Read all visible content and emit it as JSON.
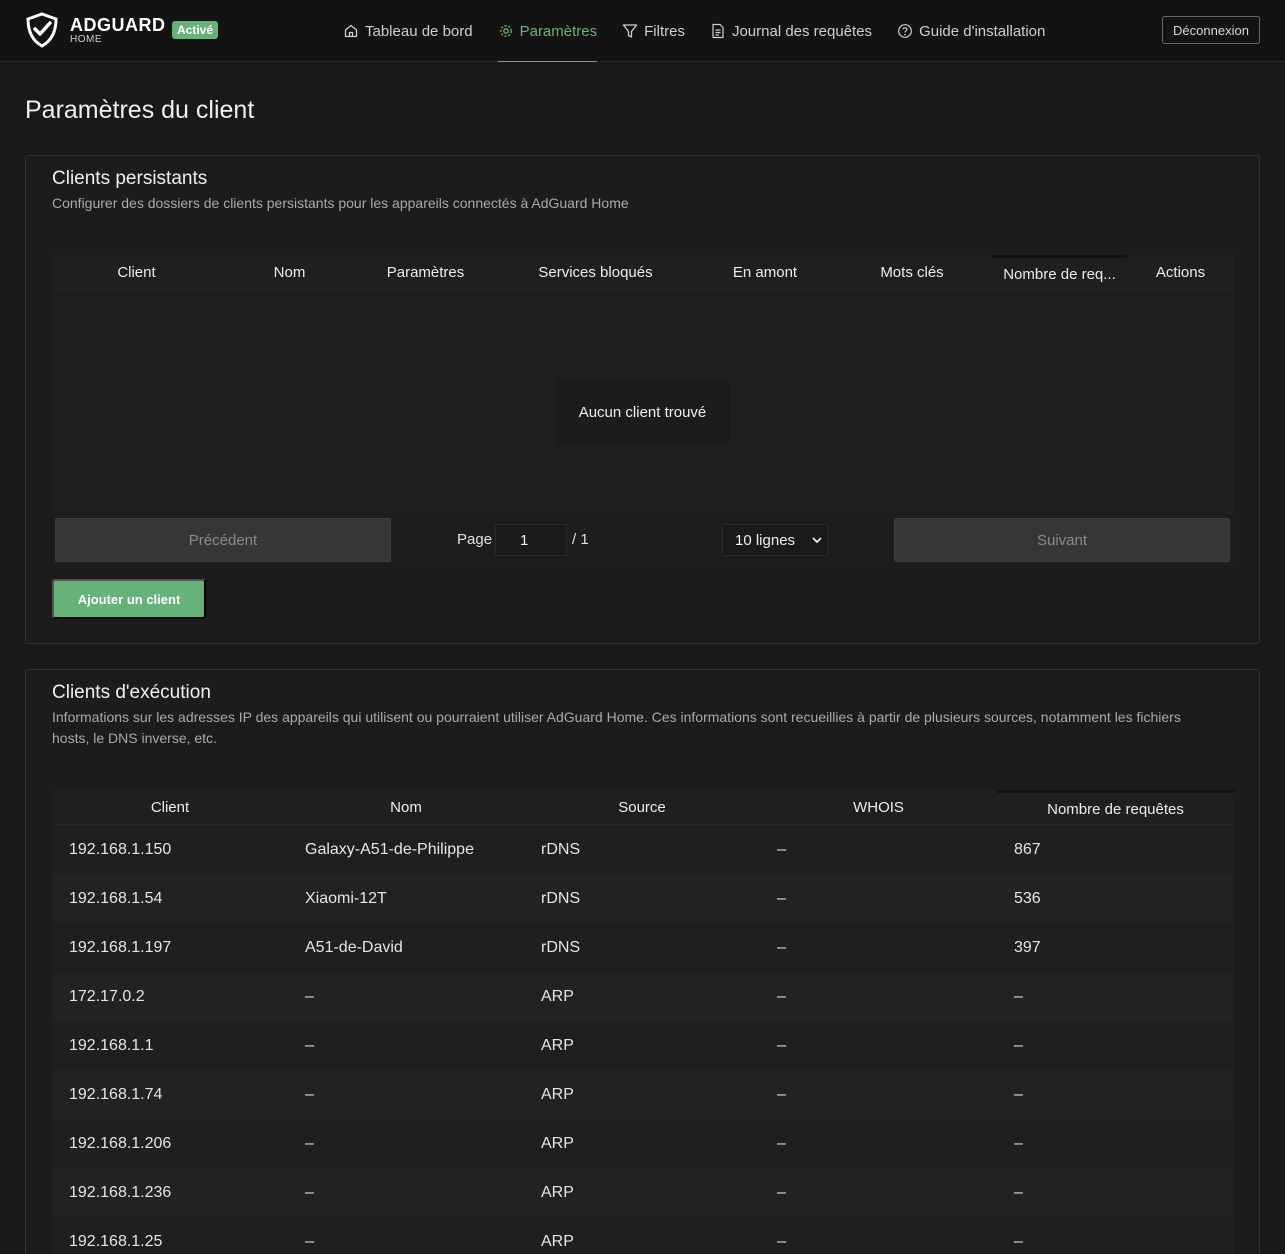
{
  "header": {
    "logo_name": "ADGUARD",
    "logo_sub": "HOME",
    "status_badge": "Activé",
    "nav": [
      {
        "label": "Tableau de bord",
        "icon": "home-icon"
      },
      {
        "label": "Paramètres",
        "icon": "gear-icon"
      },
      {
        "label": "Filtres",
        "icon": "filter-icon"
      },
      {
        "label": "Journal des requêtes",
        "icon": "document-icon"
      },
      {
        "label": "Guide d'installation",
        "icon": "help-icon"
      }
    ],
    "active_nav": "Paramètres",
    "logout_label": "Déconnexion"
  },
  "page": {
    "title": "Paramètres du client"
  },
  "persistent": {
    "title": "Clients persistants",
    "subtitle": "Configurer des dossiers de clients persistants pour les appareils connectés à AdGuard Home",
    "columns": [
      "Client",
      "Nom",
      "Paramètres",
      "Services bloqués",
      "En amont",
      "Mots clés",
      "Nombre de req...",
      "Actions"
    ],
    "sorted_column": "Nombre de req...",
    "empty_text": "Aucun client trouvé",
    "pagination": {
      "prev_label": "Précédent",
      "page_label": "Page",
      "page_value": "1",
      "page_total": "/ 1",
      "rows_label": "10 lignes",
      "next_label": "Suivant"
    },
    "add_button": "Ajouter un client"
  },
  "runtime": {
    "title": "Clients d'exécution",
    "subtitle_line1": "Informations sur les adresses IP des appareils qui utilisent ou pourraient utiliser AdGuard Home. Ces informations sont recueillies à partir de plusieurs sources, notamment les fichiers",
    "subtitle_line2": "hosts, le DNS inverse, etc.",
    "columns": [
      "Client",
      "Nom",
      "Source",
      "WHOIS",
      "Nombre de requêtes"
    ],
    "sorted_column": "Nombre de requêtes",
    "rows": [
      [
        "192.168.1.150",
        "Galaxy-A51-de-Philippe",
        "rDNS",
        "–",
        "867"
      ],
      [
        "192.168.1.54",
        "Xiaomi-12T",
        "rDNS",
        "–",
        "536"
      ],
      [
        "192.168.1.197",
        "A51-de-David",
        "rDNS",
        "–",
        "397"
      ],
      [
        "172.17.0.2",
        "–",
        "ARP",
        "–",
        "–"
      ],
      [
        "192.168.1.1",
        "–",
        "ARP",
        "–",
        "–"
      ],
      [
        "192.168.1.74",
        "–",
        "ARP",
        "–",
        "–"
      ],
      [
        "192.168.1.206",
        "–",
        "ARP",
        "–",
        "–"
      ],
      [
        "192.168.1.236",
        "–",
        "ARP",
        "–",
        "–"
      ],
      [
        "192.168.1.25",
        "–",
        "ARP",
        "–",
        "–"
      ]
    ]
  },
  "colors": {
    "accent": "#67b279",
    "background": "#191919",
    "header": "#131313"
  }
}
